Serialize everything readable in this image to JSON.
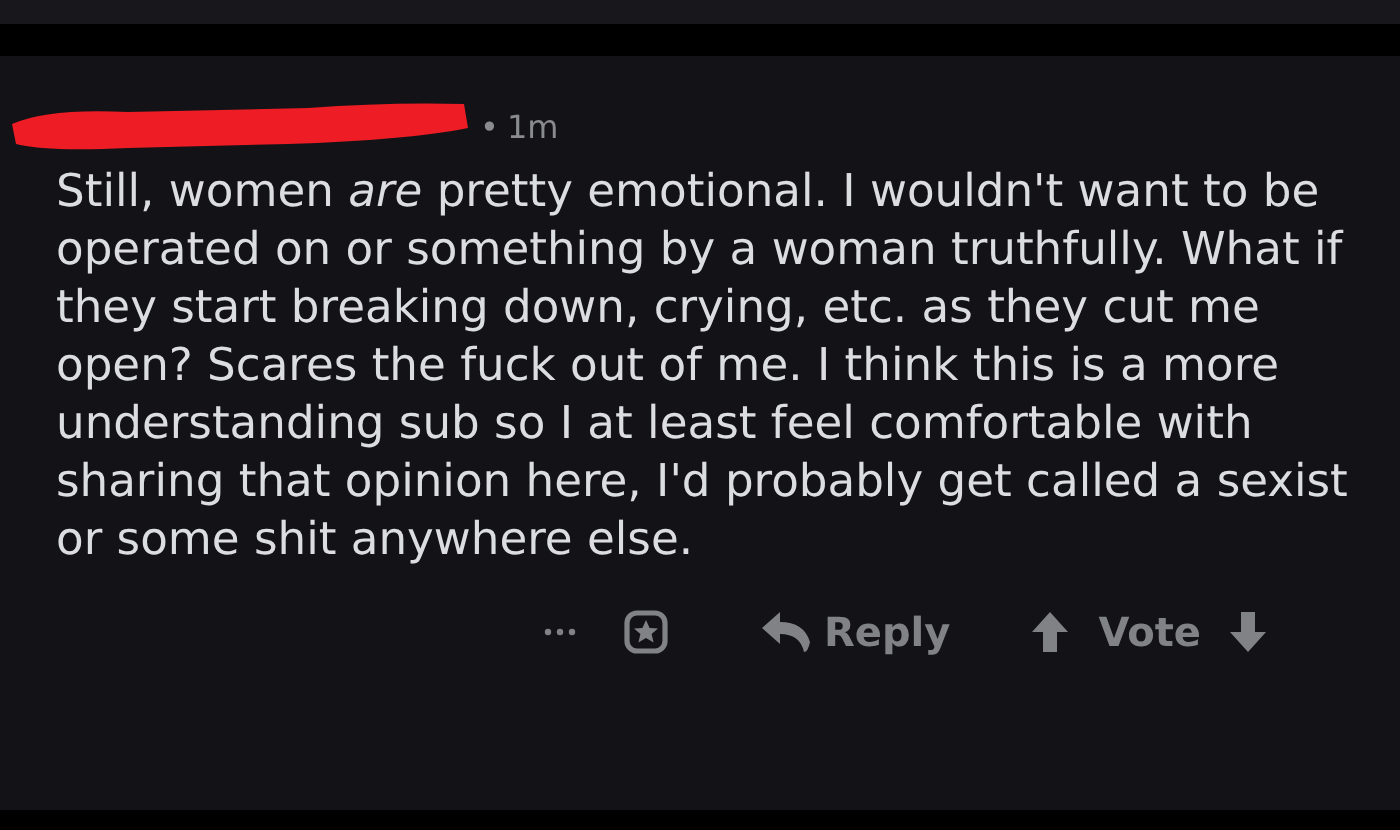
{
  "comment": {
    "separator": "•",
    "age": "1m",
    "body": "Still, women *are* pretty emotional. I wouldn't want to be operated on or something by a woman truthfully. What if they start breaking down, crying, etc. as they cut me open? Scares the fuck out of me. I think this is a more understanding sub so I at least feel comfortable with sharing that opinion here, I'd probably get called a sexist or some shit anywhere else.",
    "actions": [
      {
        "kind": "more"
      },
      {
        "kind": "award"
      },
      {
        "kind": "reply",
        "label": "Reply"
      },
      {
        "kind": "vote",
        "label": "Vote"
      }
    ]
  }
}
